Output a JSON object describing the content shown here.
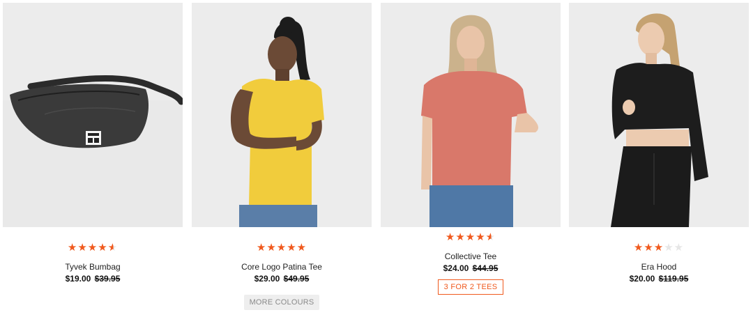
{
  "products": [
    {
      "name": "Tyvek Bumbag",
      "price": "$19.00",
      "was_price": "$39.95",
      "rating": 4.5,
      "image_icon": "bumbag-image"
    },
    {
      "name": "Core Logo Patina Tee",
      "price": "$29.00",
      "was_price": "$49.95",
      "rating": 5,
      "badge": "MORE COLOURS",
      "image_icon": "yellow-tee-image"
    },
    {
      "name": "Collective Tee",
      "price": "$24.00",
      "was_price": "$44.95",
      "rating": 4.5,
      "promo": "3 FOR 2 TEES",
      "image_icon": "pink-tee-image"
    },
    {
      "name": "Era Hood",
      "price": "$20.00",
      "was_price": "$119.95",
      "rating": 3,
      "image_icon": "black-hood-image"
    }
  ],
  "colors": {
    "accent": "#f0591d",
    "photo_bg": "#ededed"
  }
}
